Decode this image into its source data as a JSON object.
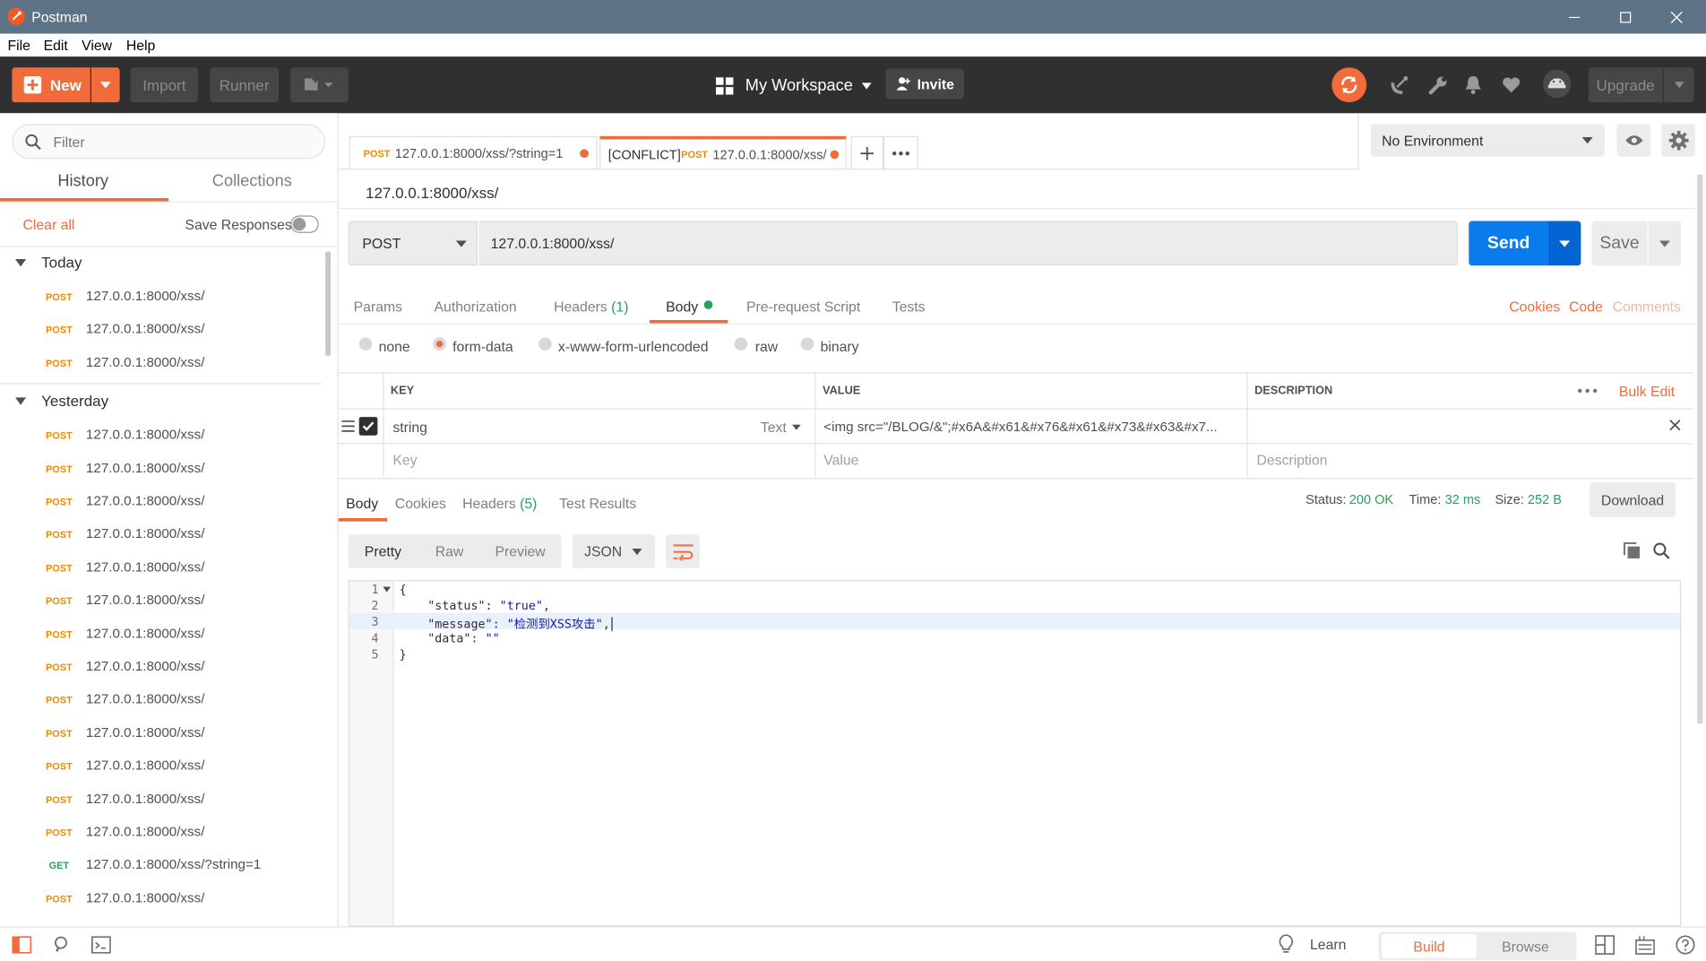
{
  "window": {
    "title": "Postman"
  },
  "menu": [
    "File",
    "Edit",
    "View",
    "Help"
  ],
  "toolbar": {
    "new_label": "New",
    "import_label": "Import",
    "runner_label": "Runner",
    "workspace_label": "My Workspace",
    "invite_label": "Invite",
    "upgrade_label": "Upgrade",
    "sync_color": "#f26b3a"
  },
  "sidebar": {
    "filter_placeholder": "Filter",
    "tabs": [
      "History",
      "Collections"
    ],
    "clear_all": "Clear all",
    "save_responses": "Save Responses",
    "groups": [
      {
        "label": "Today",
        "items": [
          {
            "method": "POST",
            "url": "127.0.0.1:8000/xss/"
          },
          {
            "method": "POST",
            "url": "127.0.0.1:8000/xss/"
          },
          {
            "method": "POST",
            "url": "127.0.0.1:8000/xss/"
          }
        ]
      },
      {
        "label": "Yesterday",
        "items": [
          {
            "method": "POST",
            "url": "127.0.0.1:8000/xss/"
          },
          {
            "method": "POST",
            "url": "127.0.0.1:8000/xss/"
          },
          {
            "method": "POST",
            "url": "127.0.0.1:8000/xss/"
          },
          {
            "method": "POST",
            "url": "127.0.0.1:8000/xss/"
          },
          {
            "method": "POST",
            "url": "127.0.0.1:8000/xss/"
          },
          {
            "method": "POST",
            "url": "127.0.0.1:8000/xss/"
          },
          {
            "method": "POST",
            "url": "127.0.0.1:8000/xss/"
          },
          {
            "method": "POST",
            "url": "127.0.0.1:8000/xss/"
          },
          {
            "method": "POST",
            "url": "127.0.0.1:8000/xss/"
          },
          {
            "method": "POST",
            "url": "127.0.0.1:8000/xss/"
          },
          {
            "method": "POST",
            "url": "127.0.0.1:8000/xss/"
          },
          {
            "method": "POST",
            "url": "127.0.0.1:8000/xss/"
          },
          {
            "method": "POST",
            "url": "127.0.0.1:8000/xss/"
          },
          {
            "method": "GET",
            "url": "127.0.0.1:8000/xss/?string=1"
          },
          {
            "method": "POST",
            "url": "127.0.0.1:8000/xss/"
          }
        ]
      }
    ]
  },
  "tabs": [
    {
      "method": "POST",
      "url": "127.0.0.1:8000/xss/?string=1"
    },
    {
      "prefix": "[CONFLICT]",
      "method": "POST",
      "url": "127.0.0.1:8000/xss/"
    }
  ],
  "environment": {
    "selected": "No Environment"
  },
  "request": {
    "name": "127.0.0.1:8000/xss/",
    "method": "POST",
    "url": "127.0.0.1:8000/xss/",
    "send_label": "Send",
    "save_label": "Save",
    "tabs": [
      "Params",
      "Authorization",
      "Headers",
      "Body",
      "Pre-request Script",
      "Tests"
    ],
    "headers_count": "(1)",
    "right_links": [
      "Cookies",
      "Code",
      "Comments"
    ],
    "body_modes": [
      "none",
      "form-data",
      "x-www-form-urlencoded",
      "raw",
      "binary"
    ],
    "selected_mode": "form-data",
    "table": {
      "headers": [
        "KEY",
        "VALUE",
        "DESCRIPTION"
      ],
      "bulk_edit": "Bulk Edit",
      "rows": [
        {
          "key": "string",
          "type": "Text",
          "value": "<img src=\"/BLOG/&\";#x6A&#x61&#x76&#x61&#x73&#x63&#x7...",
          "description": ""
        }
      ],
      "placeholders": {
        "key": "Key",
        "value": "Value",
        "description": "Description"
      }
    }
  },
  "response": {
    "tabs": [
      "Body",
      "Cookies",
      "Headers",
      "Test Results"
    ],
    "headers_count": "(5)",
    "status_label": "Status:",
    "status": "200 OK",
    "time_label": "Time:",
    "time": "32 ms",
    "size_label": "Size:",
    "size": "252 B",
    "download_label": "Download",
    "view_modes": [
      "Pretty",
      "Raw",
      "Preview"
    ],
    "format": "JSON",
    "code": {
      "line_numbers": [
        "1",
        "2",
        "3",
        "4",
        "5"
      ],
      "line1": "{",
      "status_key": "\"status\"",
      "status_val": "\"true\"",
      "message_key": "\"message\"",
      "message_val": "\"检测到XSS攻击\"",
      "data_key": "\"data\"",
      "data_val": "\"\"",
      "line5": "}"
    }
  },
  "statusbar": {
    "learn_label": "Learn",
    "build_label": "Build",
    "browse_label": "Browse"
  },
  "colors": {
    "accent": "#f26b3a",
    "post": "#ed8b00",
    "get": "#26a35b",
    "send": "#097bed",
    "ok": "#26a35b"
  }
}
